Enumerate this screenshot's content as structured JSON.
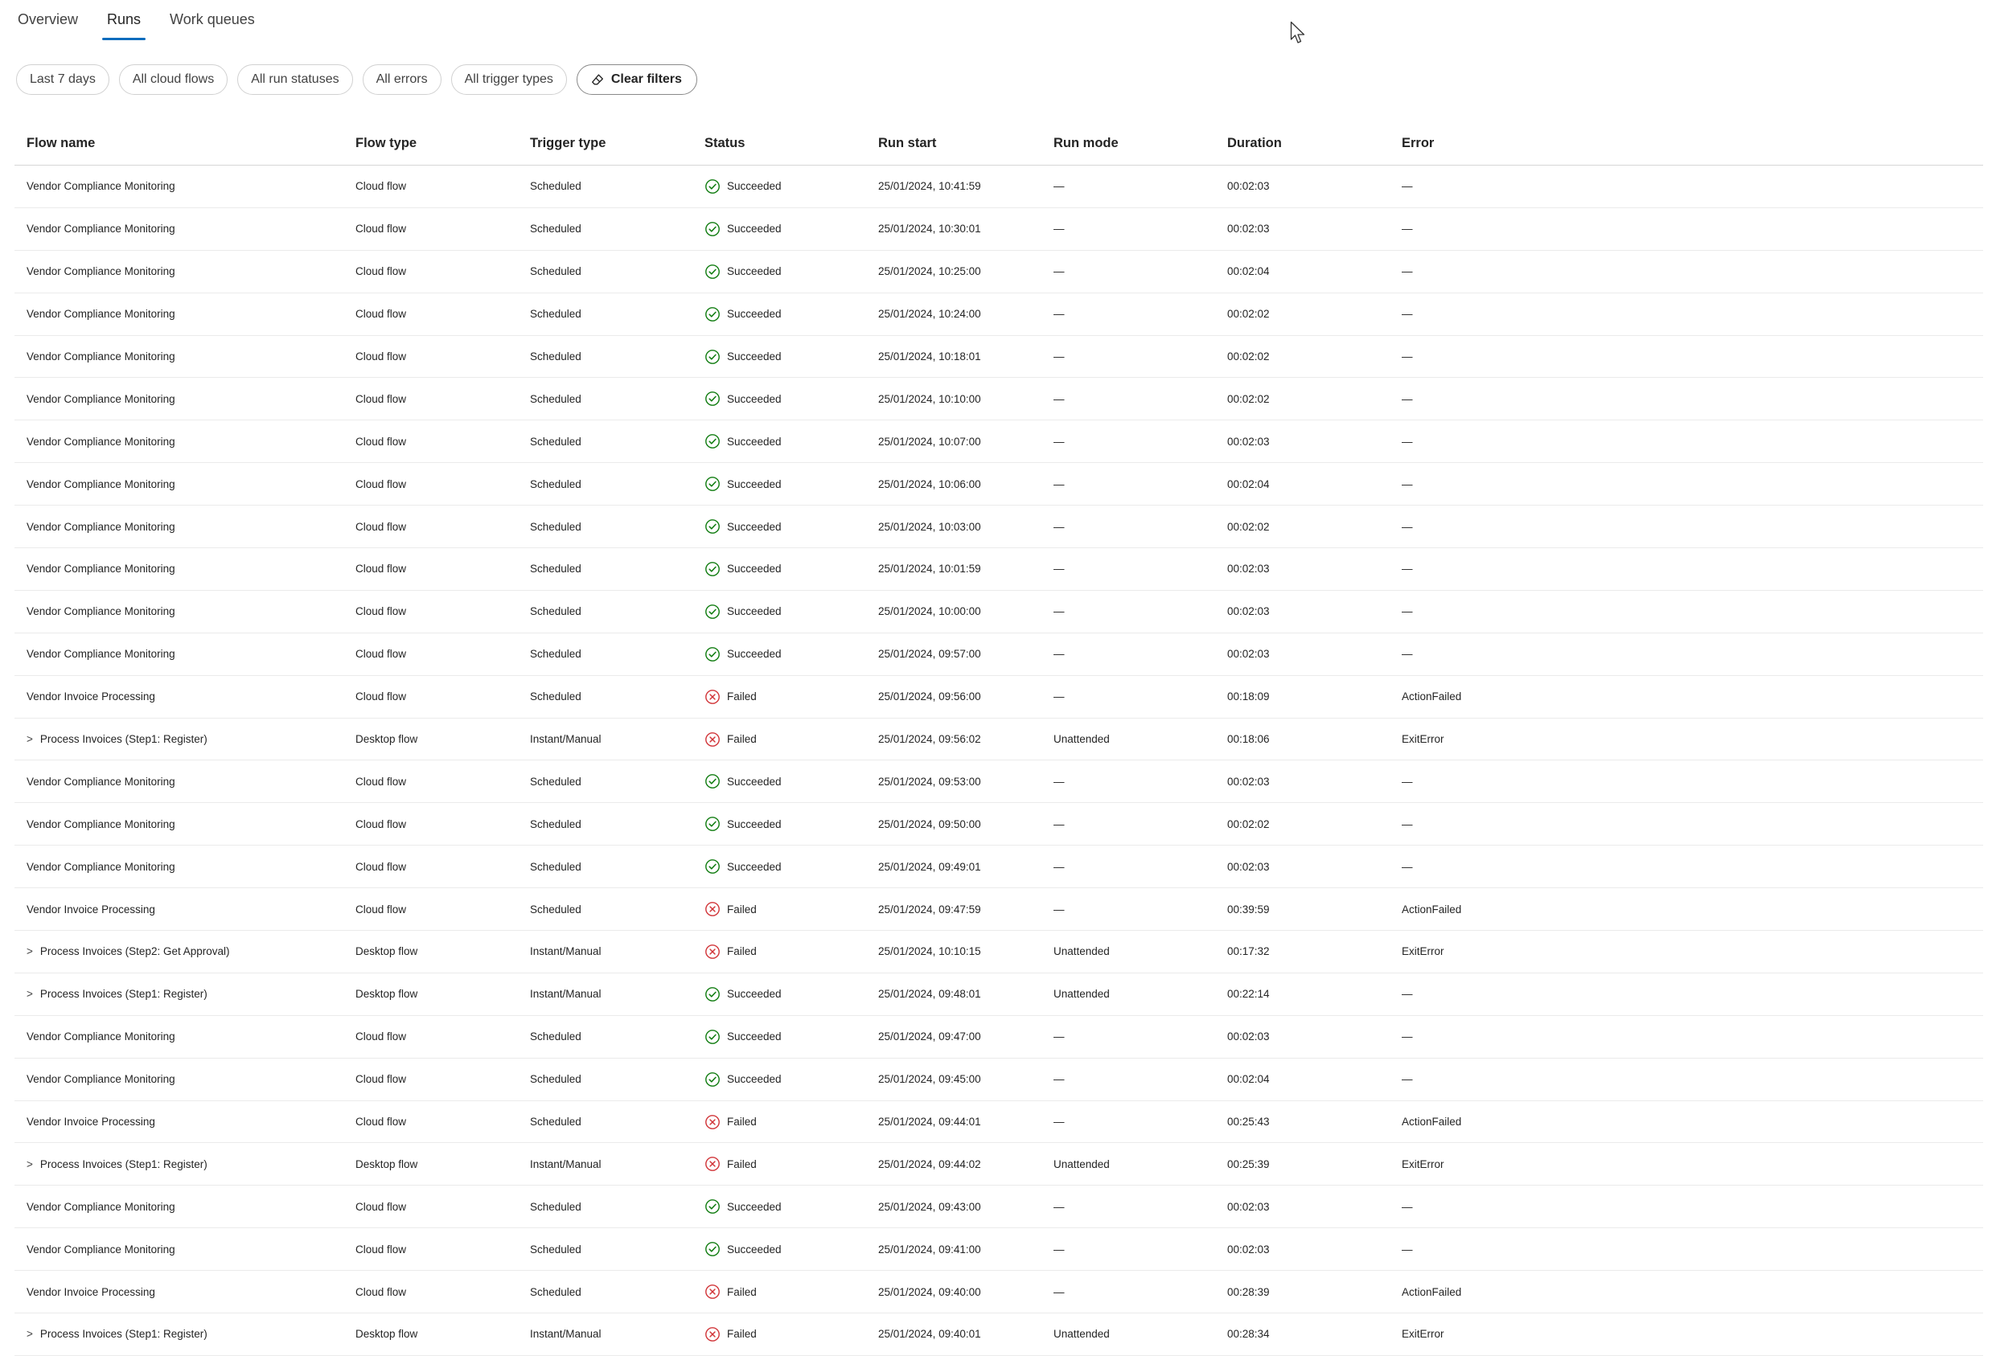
{
  "tabs": [
    {
      "label": "Overview",
      "active": false
    },
    {
      "label": "Runs",
      "active": true
    },
    {
      "label": "Work queues",
      "active": false
    }
  ],
  "filters": {
    "date": "Last 7 days",
    "flows": "All cloud flows",
    "statuses": "All run statuses",
    "errors": "All errors",
    "triggers": "All trigger types",
    "clear": "Clear filters"
  },
  "colors": {
    "accent": "#0f6cbd",
    "success": "#107c10",
    "failure": "#d13438"
  },
  "table": {
    "headers": {
      "name": "Flow name",
      "type": "Flow type",
      "trigger": "Trigger type",
      "status": "Status",
      "start": "Run start",
      "mode": "Run mode",
      "duration": "Duration",
      "error": "Error"
    },
    "rows": [
      {
        "name": "Vendor Compliance Monitoring",
        "expandable": false,
        "type": "Cloud flow",
        "trigger": "Scheduled",
        "status": "Succeeded",
        "start": "25/01/2024, 10:41:59",
        "mode": "—",
        "duration": "00:02:03",
        "error": "—"
      },
      {
        "name": "Vendor Compliance Monitoring",
        "expandable": false,
        "type": "Cloud flow",
        "trigger": "Scheduled",
        "status": "Succeeded",
        "start": "25/01/2024, 10:30:01",
        "mode": "—",
        "duration": "00:02:03",
        "error": "—"
      },
      {
        "name": "Vendor Compliance Monitoring",
        "expandable": false,
        "type": "Cloud flow",
        "trigger": "Scheduled",
        "status": "Succeeded",
        "start": "25/01/2024, 10:25:00",
        "mode": "—",
        "duration": "00:02:04",
        "error": "—"
      },
      {
        "name": "Vendor Compliance Monitoring",
        "expandable": false,
        "type": "Cloud flow",
        "trigger": "Scheduled",
        "status": "Succeeded",
        "start": "25/01/2024, 10:24:00",
        "mode": "—",
        "duration": "00:02:02",
        "error": "—"
      },
      {
        "name": "Vendor Compliance Monitoring",
        "expandable": false,
        "type": "Cloud flow",
        "trigger": "Scheduled",
        "status": "Succeeded",
        "start": "25/01/2024, 10:18:01",
        "mode": "—",
        "duration": "00:02:02",
        "error": "—"
      },
      {
        "name": "Vendor Compliance Monitoring",
        "expandable": false,
        "type": "Cloud flow",
        "trigger": "Scheduled",
        "status": "Succeeded",
        "start": "25/01/2024, 10:10:00",
        "mode": "—",
        "duration": "00:02:02",
        "error": "—"
      },
      {
        "name": "Vendor Compliance Monitoring",
        "expandable": false,
        "type": "Cloud flow",
        "trigger": "Scheduled",
        "status": "Succeeded",
        "start": "25/01/2024, 10:07:00",
        "mode": "—",
        "duration": "00:02:03",
        "error": "—"
      },
      {
        "name": "Vendor Compliance Monitoring",
        "expandable": false,
        "type": "Cloud flow",
        "trigger": "Scheduled",
        "status": "Succeeded",
        "start": "25/01/2024, 10:06:00",
        "mode": "—",
        "duration": "00:02:04",
        "error": "—"
      },
      {
        "name": "Vendor Compliance Monitoring",
        "expandable": false,
        "type": "Cloud flow",
        "trigger": "Scheduled",
        "status": "Succeeded",
        "start": "25/01/2024, 10:03:00",
        "mode": "—",
        "duration": "00:02:02",
        "error": "—"
      },
      {
        "name": "Vendor Compliance Monitoring",
        "expandable": false,
        "type": "Cloud flow",
        "trigger": "Scheduled",
        "status": "Succeeded",
        "start": "25/01/2024, 10:01:59",
        "mode": "—",
        "duration": "00:02:03",
        "error": "—"
      },
      {
        "name": "Vendor Compliance Monitoring",
        "expandable": false,
        "type": "Cloud flow",
        "trigger": "Scheduled",
        "status": "Succeeded",
        "start": "25/01/2024, 10:00:00",
        "mode": "—",
        "duration": "00:02:03",
        "error": "—"
      },
      {
        "name": "Vendor Compliance Monitoring",
        "expandable": false,
        "type": "Cloud flow",
        "trigger": "Scheduled",
        "status": "Succeeded",
        "start": "25/01/2024, 09:57:00",
        "mode": "—",
        "duration": "00:02:03",
        "error": "—"
      },
      {
        "name": "Vendor Invoice Processing",
        "expandable": false,
        "type": "Cloud flow",
        "trigger": "Scheduled",
        "status": "Failed",
        "start": "25/01/2024, 09:56:00",
        "mode": "—",
        "duration": "00:18:09",
        "error": "ActionFailed"
      },
      {
        "name": "Process Invoices (Step1: Register)",
        "expandable": true,
        "type": "Desktop flow",
        "trigger": "Instant/Manual",
        "status": "Failed",
        "start": "25/01/2024, 09:56:02",
        "mode": "Unattended",
        "duration": "00:18:06",
        "error": "ExitError"
      },
      {
        "name": "Vendor Compliance Monitoring",
        "expandable": false,
        "type": "Cloud flow",
        "trigger": "Scheduled",
        "status": "Succeeded",
        "start": "25/01/2024, 09:53:00",
        "mode": "—",
        "duration": "00:02:03",
        "error": "—"
      },
      {
        "name": "Vendor Compliance Monitoring",
        "expandable": false,
        "type": "Cloud flow",
        "trigger": "Scheduled",
        "status": "Succeeded",
        "start": "25/01/2024, 09:50:00",
        "mode": "—",
        "duration": "00:02:02",
        "error": "—"
      },
      {
        "name": "Vendor Compliance Monitoring",
        "expandable": false,
        "type": "Cloud flow",
        "trigger": "Scheduled",
        "status": "Succeeded",
        "start": "25/01/2024, 09:49:01",
        "mode": "—",
        "duration": "00:02:03",
        "error": "—"
      },
      {
        "name": "Vendor Invoice Processing",
        "expandable": false,
        "type": "Cloud flow",
        "trigger": "Scheduled",
        "status": "Failed",
        "start": "25/01/2024, 09:47:59",
        "mode": "—",
        "duration": "00:39:59",
        "error": "ActionFailed"
      },
      {
        "name": "Process Invoices (Step2: Get Approval)",
        "expandable": true,
        "type": "Desktop flow",
        "trigger": "Instant/Manual",
        "status": "Failed",
        "start": "25/01/2024, 10:10:15",
        "mode": "Unattended",
        "duration": "00:17:32",
        "error": "ExitError"
      },
      {
        "name": "Process Invoices (Step1: Register)",
        "expandable": true,
        "type": "Desktop flow",
        "trigger": "Instant/Manual",
        "status": "Succeeded",
        "start": "25/01/2024, 09:48:01",
        "mode": "Unattended",
        "duration": "00:22:14",
        "error": "—"
      },
      {
        "name": "Vendor Compliance Monitoring",
        "expandable": false,
        "type": "Cloud flow",
        "trigger": "Scheduled",
        "status": "Succeeded",
        "start": "25/01/2024, 09:47:00",
        "mode": "—",
        "duration": "00:02:03",
        "error": "—"
      },
      {
        "name": "Vendor Compliance Monitoring",
        "expandable": false,
        "type": "Cloud flow",
        "trigger": "Scheduled",
        "status": "Succeeded",
        "start": "25/01/2024, 09:45:00",
        "mode": "—",
        "duration": "00:02:04",
        "error": "—"
      },
      {
        "name": "Vendor Invoice Processing",
        "expandable": false,
        "type": "Cloud flow",
        "trigger": "Scheduled",
        "status": "Failed",
        "start": "25/01/2024, 09:44:01",
        "mode": "—",
        "duration": "00:25:43",
        "error": "ActionFailed"
      },
      {
        "name": "Process Invoices (Step1: Register)",
        "expandable": true,
        "type": "Desktop flow",
        "trigger": "Instant/Manual",
        "status": "Failed",
        "start": "25/01/2024, 09:44:02",
        "mode": "Unattended",
        "duration": "00:25:39",
        "error": "ExitError"
      },
      {
        "name": "Vendor Compliance Monitoring",
        "expandable": false,
        "type": "Cloud flow",
        "trigger": "Scheduled",
        "status": "Succeeded",
        "start": "25/01/2024, 09:43:00",
        "mode": "—",
        "duration": "00:02:03",
        "error": "—"
      },
      {
        "name": "Vendor Compliance Monitoring",
        "expandable": false,
        "type": "Cloud flow",
        "trigger": "Scheduled",
        "status": "Succeeded",
        "start": "25/01/2024, 09:41:00",
        "mode": "—",
        "duration": "00:02:03",
        "error": "—"
      },
      {
        "name": "Vendor Invoice Processing",
        "expandable": false,
        "type": "Cloud flow",
        "trigger": "Scheduled",
        "status": "Failed",
        "start": "25/01/2024, 09:40:00",
        "mode": "—",
        "duration": "00:28:39",
        "error": "ActionFailed"
      },
      {
        "name": "Process Invoices (Step1: Register)",
        "expandable": true,
        "type": "Desktop flow",
        "trigger": "Instant/Manual",
        "status": "Failed",
        "start": "25/01/2024, 09:40:01",
        "mode": "Unattended",
        "duration": "00:28:34",
        "error": "ExitError"
      }
    ]
  }
}
